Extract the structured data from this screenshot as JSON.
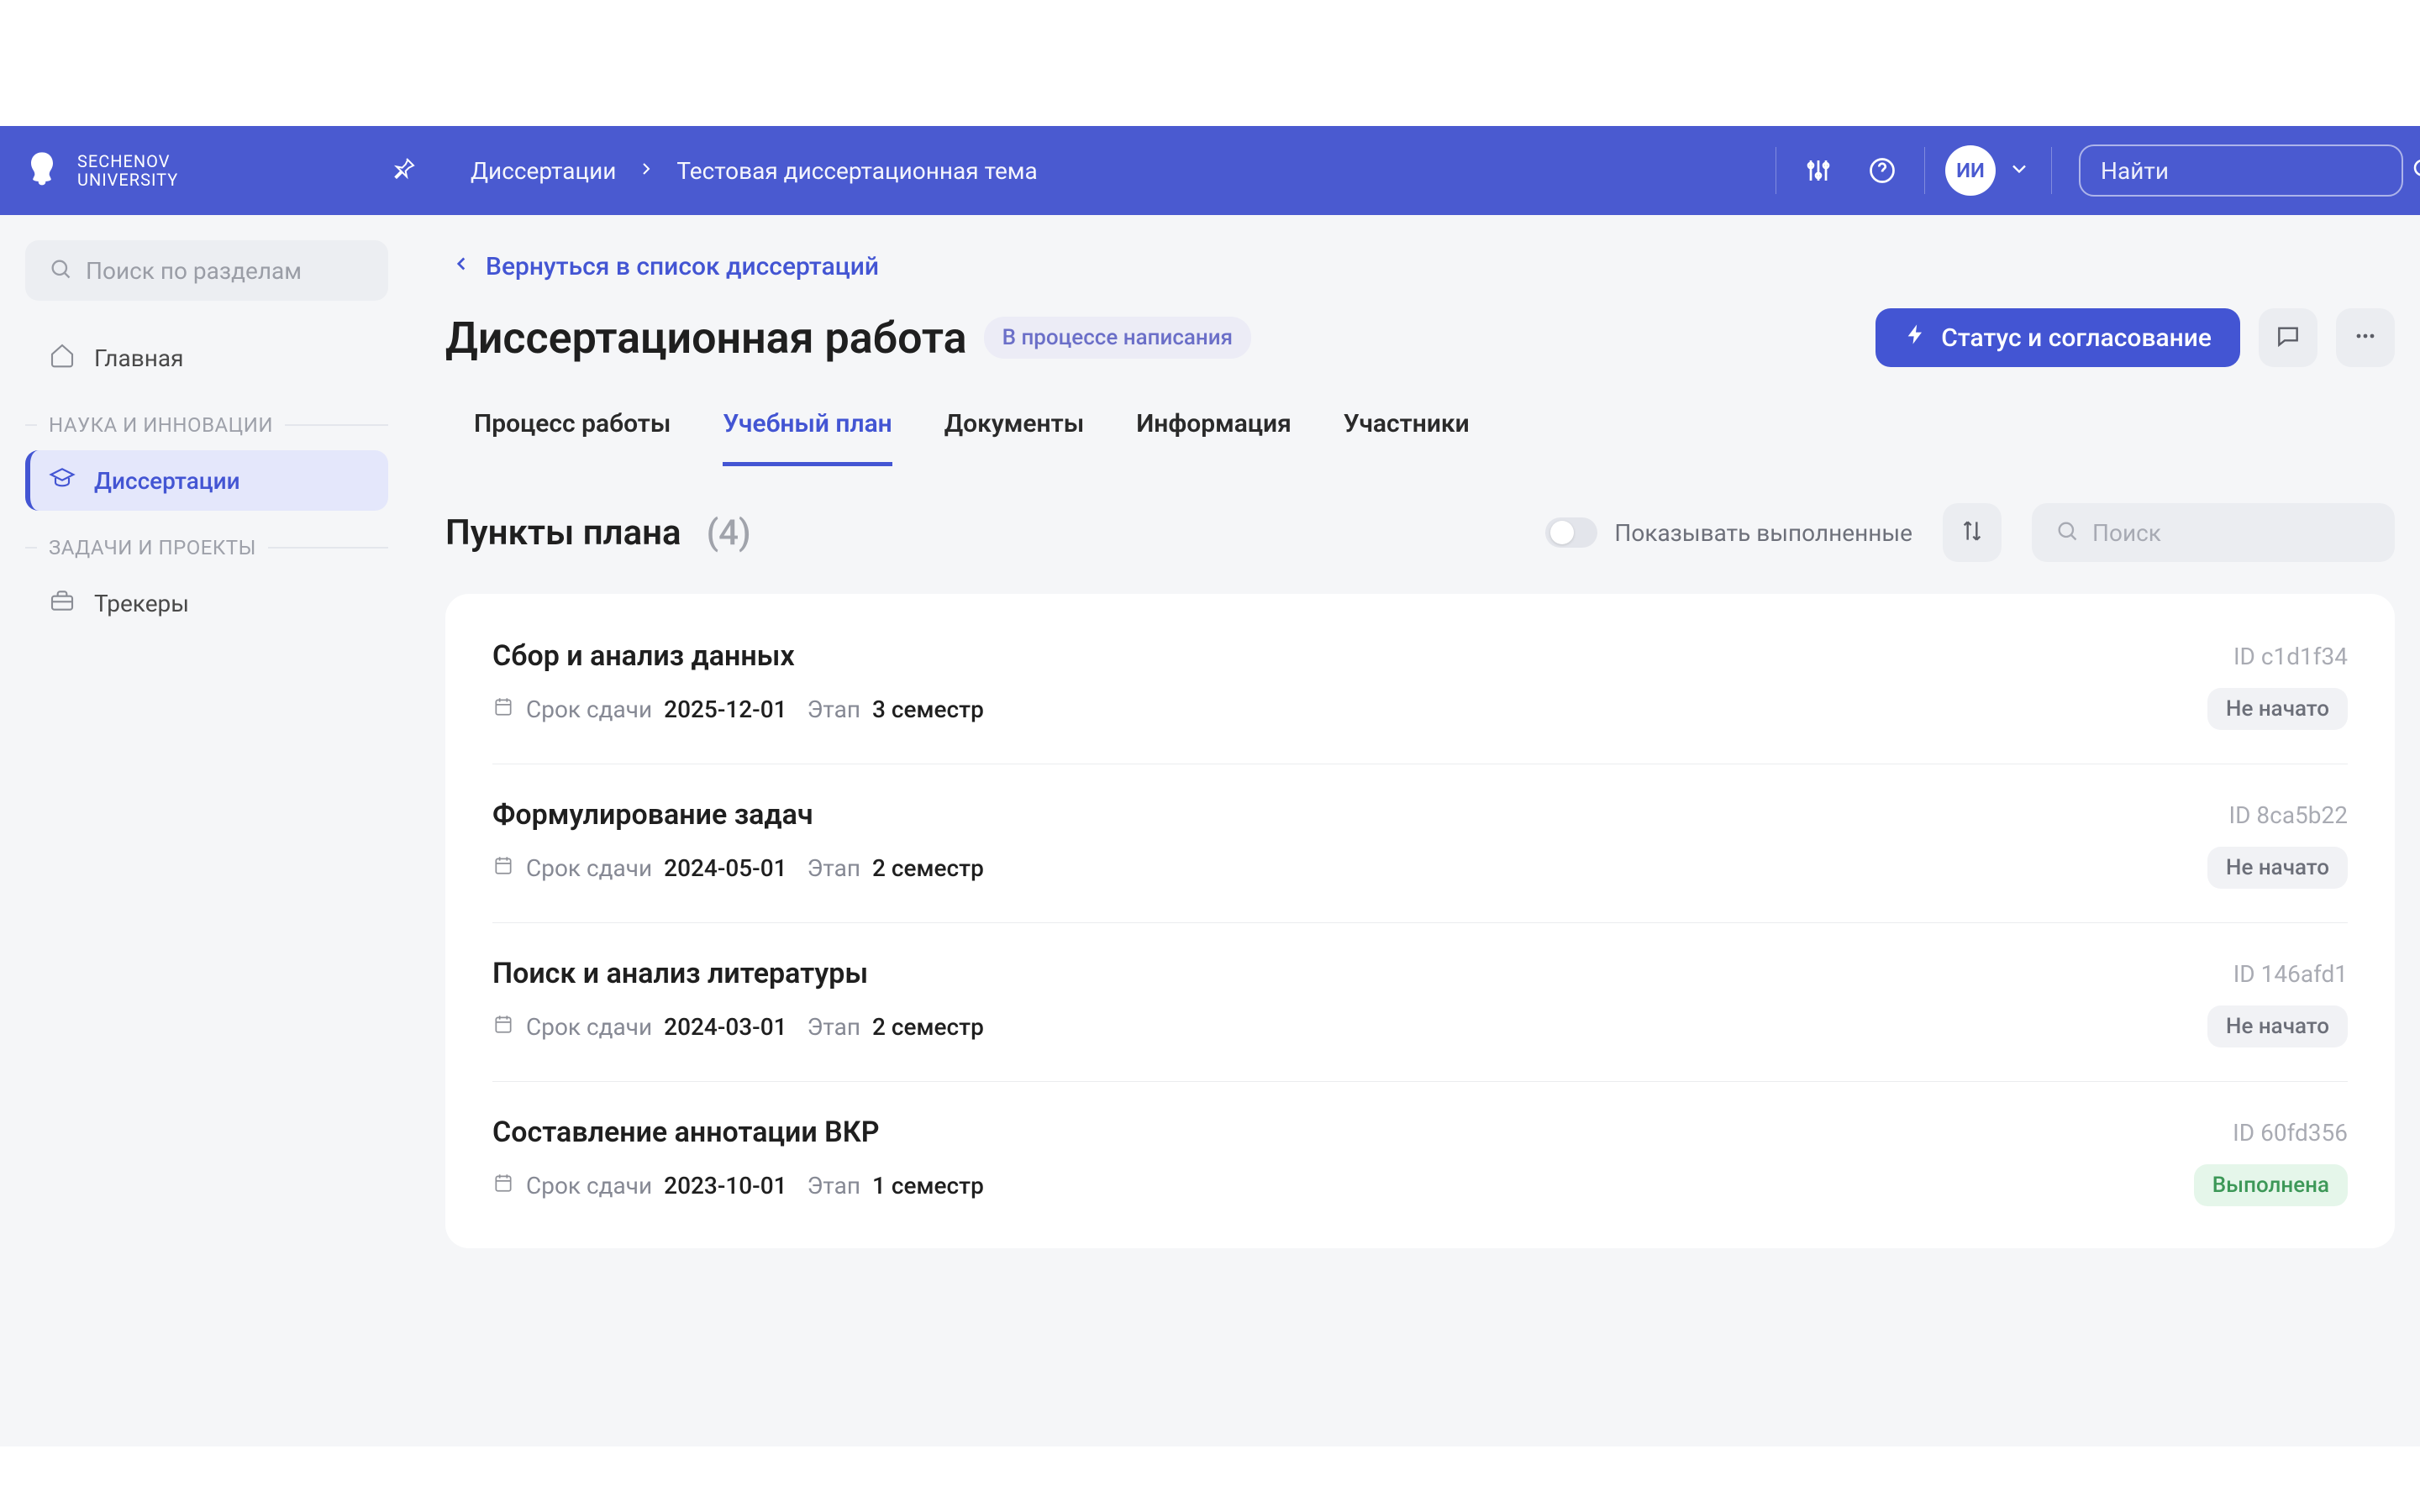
{
  "header": {
    "logo_line1": "SECHENOV",
    "logo_line2": "UNIVERSITY",
    "breadcrumbs": [
      "Диссертации",
      "Тестовая диссертационная тема"
    ],
    "avatar": "ИИ",
    "search_placeholder": "Найти"
  },
  "sidebar": {
    "search_placeholder": "Поиск по разделам",
    "items": [
      {
        "label": "Главная",
        "icon": "home"
      },
      {
        "group": "НАУКА И ИННОВАЦИИ"
      },
      {
        "label": "Диссертации",
        "icon": "grad",
        "active": true
      },
      {
        "group": "ЗАДАЧИ И ПРОЕКТЫ"
      },
      {
        "label": "Трекеры",
        "icon": "brief"
      }
    ]
  },
  "page": {
    "back": "Вернуться в список диссертаций",
    "title": "Диссертационная работа",
    "badge": "В процессе написания",
    "status_btn": "Статус и согласование",
    "tabs": [
      "Процесс работы",
      "Учебный план",
      "Документы",
      "Информация",
      "Участники"
    ],
    "active_tab": 1,
    "plan_title": "Пункты плана",
    "plan_count": "(4)",
    "toggle_label": "Показывать выполненные",
    "plan_search_placeholder": "Поиск",
    "meta_due": "Срок сдачи",
    "meta_stage": "Этап",
    "id_prefix": "ID",
    "rows": [
      {
        "title": "Сбор и анализ данных",
        "id": "c1d1f34",
        "due": "2025-12-01",
        "stage": "3 семестр",
        "status": "Не начато",
        "status_cls": "grey"
      },
      {
        "title": "Формулирование задач",
        "id": "8ca5b22",
        "due": "2024-05-01",
        "stage": "2 семестр",
        "status": "Не начато",
        "status_cls": "grey"
      },
      {
        "title": "Поиск и анализ литературы",
        "id": "146afd1",
        "due": "2024-03-01",
        "stage": "2 семестр",
        "status": "Не начато",
        "status_cls": "grey"
      },
      {
        "title": "Составление аннотации ВКР",
        "id": "60fd356",
        "due": "2023-10-01",
        "stage": "1 семестр",
        "status": "Выполнена",
        "status_cls": "green"
      }
    ]
  }
}
